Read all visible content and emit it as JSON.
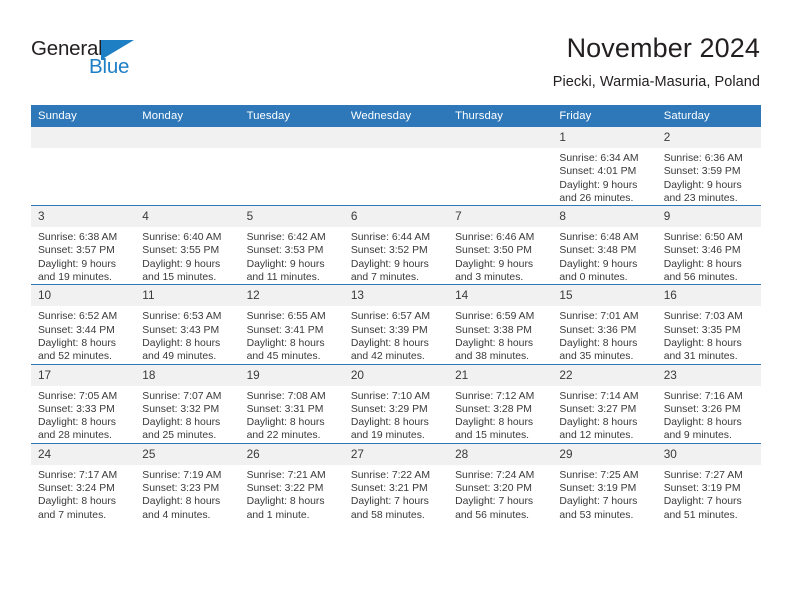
{
  "brand": {
    "name_top": "General",
    "name_bottom": "Blue",
    "accent_color": "#1f7fc4",
    "flag_icon": "triangle-flag-icon"
  },
  "header": {
    "month_title": "November 2024",
    "location": "Piecki, Warmia-Masuria, Poland"
  },
  "calendar": {
    "header_bg": "#2e78b9",
    "daynum_bg": "#f1f1f1",
    "weekdays": [
      "Sunday",
      "Monday",
      "Tuesday",
      "Wednesday",
      "Thursday",
      "Friday",
      "Saturday"
    ],
    "weeks": [
      [
        {
          "day": "",
          "blank": true,
          "sunrise": "",
          "sunset": "",
          "daylight1": "",
          "daylight2": ""
        },
        {
          "day": "",
          "blank": true,
          "sunrise": "",
          "sunset": "",
          "daylight1": "",
          "daylight2": ""
        },
        {
          "day": "",
          "blank": true,
          "sunrise": "",
          "sunset": "",
          "daylight1": "",
          "daylight2": ""
        },
        {
          "day": "",
          "blank": true,
          "sunrise": "",
          "sunset": "",
          "daylight1": "",
          "daylight2": ""
        },
        {
          "day": "",
          "blank": true,
          "sunrise": "",
          "sunset": "",
          "daylight1": "",
          "daylight2": ""
        },
        {
          "day": "1",
          "blank": false,
          "sunrise": "Sunrise: 6:34 AM",
          "sunset": "Sunset: 4:01 PM",
          "daylight1": "Daylight: 9 hours",
          "daylight2": "and 26 minutes."
        },
        {
          "day": "2",
          "blank": false,
          "sunrise": "Sunrise: 6:36 AM",
          "sunset": "Sunset: 3:59 PM",
          "daylight1": "Daylight: 9 hours",
          "daylight2": "and 23 minutes."
        }
      ],
      [
        {
          "day": "3",
          "blank": false,
          "sunrise": "Sunrise: 6:38 AM",
          "sunset": "Sunset: 3:57 PM",
          "daylight1": "Daylight: 9 hours",
          "daylight2": "and 19 minutes."
        },
        {
          "day": "4",
          "blank": false,
          "sunrise": "Sunrise: 6:40 AM",
          "sunset": "Sunset: 3:55 PM",
          "daylight1": "Daylight: 9 hours",
          "daylight2": "and 15 minutes."
        },
        {
          "day": "5",
          "blank": false,
          "sunrise": "Sunrise: 6:42 AM",
          "sunset": "Sunset: 3:53 PM",
          "daylight1": "Daylight: 9 hours",
          "daylight2": "and 11 minutes."
        },
        {
          "day": "6",
          "blank": false,
          "sunrise": "Sunrise: 6:44 AM",
          "sunset": "Sunset: 3:52 PM",
          "daylight1": "Daylight: 9 hours",
          "daylight2": "and 7 minutes."
        },
        {
          "day": "7",
          "blank": false,
          "sunrise": "Sunrise: 6:46 AM",
          "sunset": "Sunset: 3:50 PM",
          "daylight1": "Daylight: 9 hours",
          "daylight2": "and 3 minutes."
        },
        {
          "day": "8",
          "blank": false,
          "sunrise": "Sunrise: 6:48 AM",
          "sunset": "Sunset: 3:48 PM",
          "daylight1": "Daylight: 9 hours",
          "daylight2": "and 0 minutes."
        },
        {
          "day": "9",
          "blank": false,
          "sunrise": "Sunrise: 6:50 AM",
          "sunset": "Sunset: 3:46 PM",
          "daylight1": "Daylight: 8 hours",
          "daylight2": "and 56 minutes."
        }
      ],
      [
        {
          "day": "10",
          "blank": false,
          "sunrise": "Sunrise: 6:52 AM",
          "sunset": "Sunset: 3:44 PM",
          "daylight1": "Daylight: 8 hours",
          "daylight2": "and 52 minutes."
        },
        {
          "day": "11",
          "blank": false,
          "sunrise": "Sunrise: 6:53 AM",
          "sunset": "Sunset: 3:43 PM",
          "daylight1": "Daylight: 8 hours",
          "daylight2": "and 49 minutes."
        },
        {
          "day": "12",
          "blank": false,
          "sunrise": "Sunrise: 6:55 AM",
          "sunset": "Sunset: 3:41 PM",
          "daylight1": "Daylight: 8 hours",
          "daylight2": "and 45 minutes."
        },
        {
          "day": "13",
          "blank": false,
          "sunrise": "Sunrise: 6:57 AM",
          "sunset": "Sunset: 3:39 PM",
          "daylight1": "Daylight: 8 hours",
          "daylight2": "and 42 minutes."
        },
        {
          "day": "14",
          "blank": false,
          "sunrise": "Sunrise: 6:59 AM",
          "sunset": "Sunset: 3:38 PM",
          "daylight1": "Daylight: 8 hours",
          "daylight2": "and 38 minutes."
        },
        {
          "day": "15",
          "blank": false,
          "sunrise": "Sunrise: 7:01 AM",
          "sunset": "Sunset: 3:36 PM",
          "daylight1": "Daylight: 8 hours",
          "daylight2": "and 35 minutes."
        },
        {
          "day": "16",
          "blank": false,
          "sunrise": "Sunrise: 7:03 AM",
          "sunset": "Sunset: 3:35 PM",
          "daylight1": "Daylight: 8 hours",
          "daylight2": "and 31 minutes."
        }
      ],
      [
        {
          "day": "17",
          "blank": false,
          "sunrise": "Sunrise: 7:05 AM",
          "sunset": "Sunset: 3:33 PM",
          "daylight1": "Daylight: 8 hours",
          "daylight2": "and 28 minutes."
        },
        {
          "day": "18",
          "blank": false,
          "sunrise": "Sunrise: 7:07 AM",
          "sunset": "Sunset: 3:32 PM",
          "daylight1": "Daylight: 8 hours",
          "daylight2": "and 25 minutes."
        },
        {
          "day": "19",
          "blank": false,
          "sunrise": "Sunrise: 7:08 AM",
          "sunset": "Sunset: 3:31 PM",
          "daylight1": "Daylight: 8 hours",
          "daylight2": "and 22 minutes."
        },
        {
          "day": "20",
          "blank": false,
          "sunrise": "Sunrise: 7:10 AM",
          "sunset": "Sunset: 3:29 PM",
          "daylight1": "Daylight: 8 hours",
          "daylight2": "and 19 minutes."
        },
        {
          "day": "21",
          "blank": false,
          "sunrise": "Sunrise: 7:12 AM",
          "sunset": "Sunset: 3:28 PM",
          "daylight1": "Daylight: 8 hours",
          "daylight2": "and 15 minutes."
        },
        {
          "day": "22",
          "blank": false,
          "sunrise": "Sunrise: 7:14 AM",
          "sunset": "Sunset: 3:27 PM",
          "daylight1": "Daylight: 8 hours",
          "daylight2": "and 12 minutes."
        },
        {
          "day": "23",
          "blank": false,
          "sunrise": "Sunrise: 7:16 AM",
          "sunset": "Sunset: 3:26 PM",
          "daylight1": "Daylight: 8 hours",
          "daylight2": "and 9 minutes."
        }
      ],
      [
        {
          "day": "24",
          "blank": false,
          "sunrise": "Sunrise: 7:17 AM",
          "sunset": "Sunset: 3:24 PM",
          "daylight1": "Daylight: 8 hours",
          "daylight2": "and 7 minutes."
        },
        {
          "day": "25",
          "blank": false,
          "sunrise": "Sunrise: 7:19 AM",
          "sunset": "Sunset: 3:23 PM",
          "daylight1": "Daylight: 8 hours",
          "daylight2": "and 4 minutes."
        },
        {
          "day": "26",
          "blank": false,
          "sunrise": "Sunrise: 7:21 AM",
          "sunset": "Sunset: 3:22 PM",
          "daylight1": "Daylight: 8 hours",
          "daylight2": "and 1 minute."
        },
        {
          "day": "27",
          "blank": false,
          "sunrise": "Sunrise: 7:22 AM",
          "sunset": "Sunset: 3:21 PM",
          "daylight1": "Daylight: 7 hours",
          "daylight2": "and 58 minutes."
        },
        {
          "day": "28",
          "blank": false,
          "sunrise": "Sunrise: 7:24 AM",
          "sunset": "Sunset: 3:20 PM",
          "daylight1": "Daylight: 7 hours",
          "daylight2": "and 56 minutes."
        },
        {
          "day": "29",
          "blank": false,
          "sunrise": "Sunrise: 7:25 AM",
          "sunset": "Sunset: 3:19 PM",
          "daylight1": "Daylight: 7 hours",
          "daylight2": "and 53 minutes."
        },
        {
          "day": "30",
          "blank": false,
          "sunrise": "Sunrise: 7:27 AM",
          "sunset": "Sunset: 3:19 PM",
          "daylight1": "Daylight: 7 hours",
          "daylight2": "and 51 minutes."
        }
      ]
    ]
  }
}
